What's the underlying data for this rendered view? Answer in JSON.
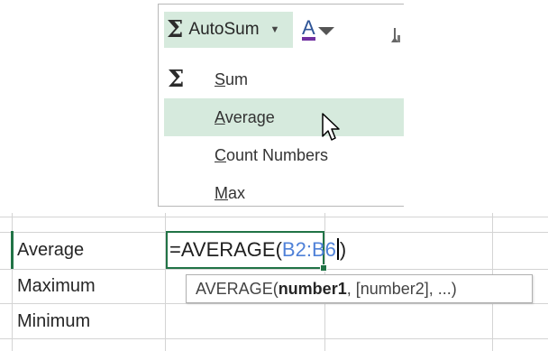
{
  "ribbon": {
    "autosum_symbol": "Σ",
    "autosum_label": "AutoSum",
    "autosum_caret": "▼",
    "font_color_letter": "A"
  },
  "menu": {
    "items": [
      {
        "icon": "Σ",
        "label_ul": "S",
        "label_rest": "um"
      },
      {
        "icon": "",
        "label_ul": "A",
        "label_rest": "verage"
      },
      {
        "icon": "",
        "label_ul": "C",
        "label_rest": "ount Numbers"
      },
      {
        "icon": "",
        "label_ul": "M",
        "label_rest": "ax"
      }
    ]
  },
  "sheet": {
    "rows": [
      "Average",
      "Maximum",
      "Minimum"
    ],
    "formula_prefix": "=AVERAGE(",
    "formula_ref": "B2:B6",
    "formula_suffix": ")",
    "tooltip_fn": "AVERAGE(",
    "tooltip_arg1": "number1",
    "tooltip_rest": ", [number2], ...)"
  },
  "colors": {
    "highlight": "#d6eadd",
    "active_border": "#217346",
    "ref_blue": "#4f81d8",
    "font_color_bar": "#7030a0"
  }
}
